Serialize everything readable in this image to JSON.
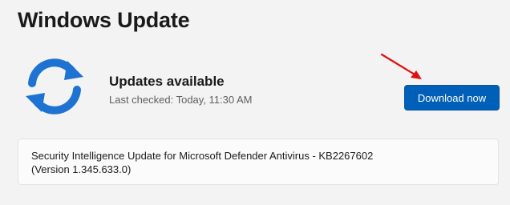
{
  "header": {
    "title": "Windows Update"
  },
  "status": {
    "icon": "sync-icon",
    "title": "Updates available",
    "last_checked": "Last checked: Today, 11:30 AM"
  },
  "actions": {
    "download_label": "Download now"
  },
  "updates": [
    {
      "name": "Security Intelligence Update for Microsoft Defender Antivirus - KB2267602",
      "version": "(Version 1.345.633.0)"
    }
  ],
  "colors": {
    "accent": "#005fb8",
    "icon_blue": "#1e73d2",
    "annotation_arrow": "#e01010",
    "background": "#f3f3f3"
  }
}
